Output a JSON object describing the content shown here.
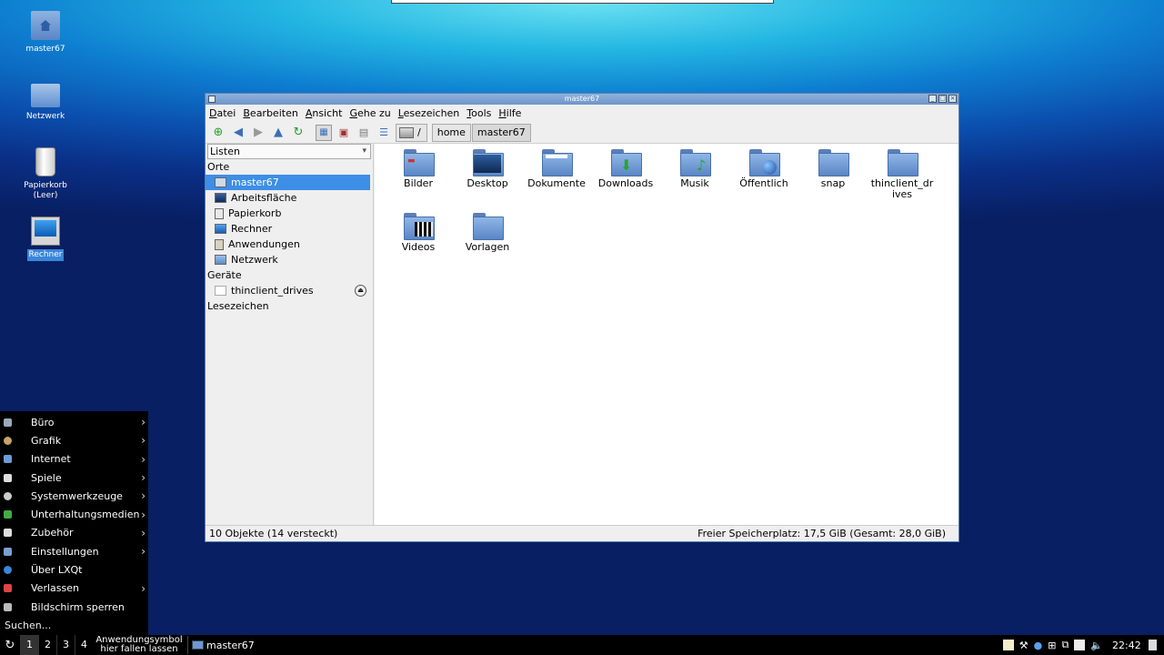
{
  "desktop": {
    "icons": [
      {
        "label": "master67"
      },
      {
        "label": "Netzwerk"
      },
      {
        "label": "Papierkorb",
        "label2": "(Leer)"
      },
      {
        "label": "Rechner"
      }
    ]
  },
  "window": {
    "title": "master67",
    "menu": [
      "Datei",
      "Bearbeiten",
      "Ansicht",
      "Gehe zu",
      "Lesezeichen",
      "Tools",
      "Hilfe"
    ],
    "path": {
      "root": "/",
      "segments": [
        "home",
        "master67"
      ]
    },
    "sidebar": {
      "mode": "Listen",
      "places_header": "Orte",
      "places": [
        "master67",
        "Arbeitsfläche",
        "Papierkorb",
        "Rechner",
        "Anwendungen",
        "Netzwerk"
      ],
      "devices_header": "Geräte",
      "devices": [
        "thinclient_drives"
      ],
      "bookmarks_header": "Lesezeichen"
    },
    "files": [
      "Bilder",
      "Desktop",
      "Dokumente",
      "Downloads",
      "Musik",
      "Öffentlich",
      "snap",
      "thinclient_drives",
      "Videos",
      "Vorlagen"
    ],
    "status": {
      "left": "10 Objekte (14 versteckt)",
      "right": "Freier Speicherplatz: 17,5 GiB (Gesamt: 28,0 GiB)"
    }
  },
  "startmenu": {
    "items": [
      "Büro",
      "Grafik",
      "Internet",
      "Spiele",
      "Systemwerkzeuge",
      "Unterhaltungsmedien",
      "Zubehör",
      "Einstellungen",
      "Über LXQt",
      "Verlassen",
      "Bildschirm sperren"
    ],
    "search": "Suchen..."
  },
  "taskbar": {
    "desktops": [
      "1",
      "2",
      "3",
      "4"
    ],
    "drop_line1": "Anwendungsymbol",
    "drop_line2": "hier fallen lassen",
    "task": "master67",
    "clock": "22:42"
  }
}
